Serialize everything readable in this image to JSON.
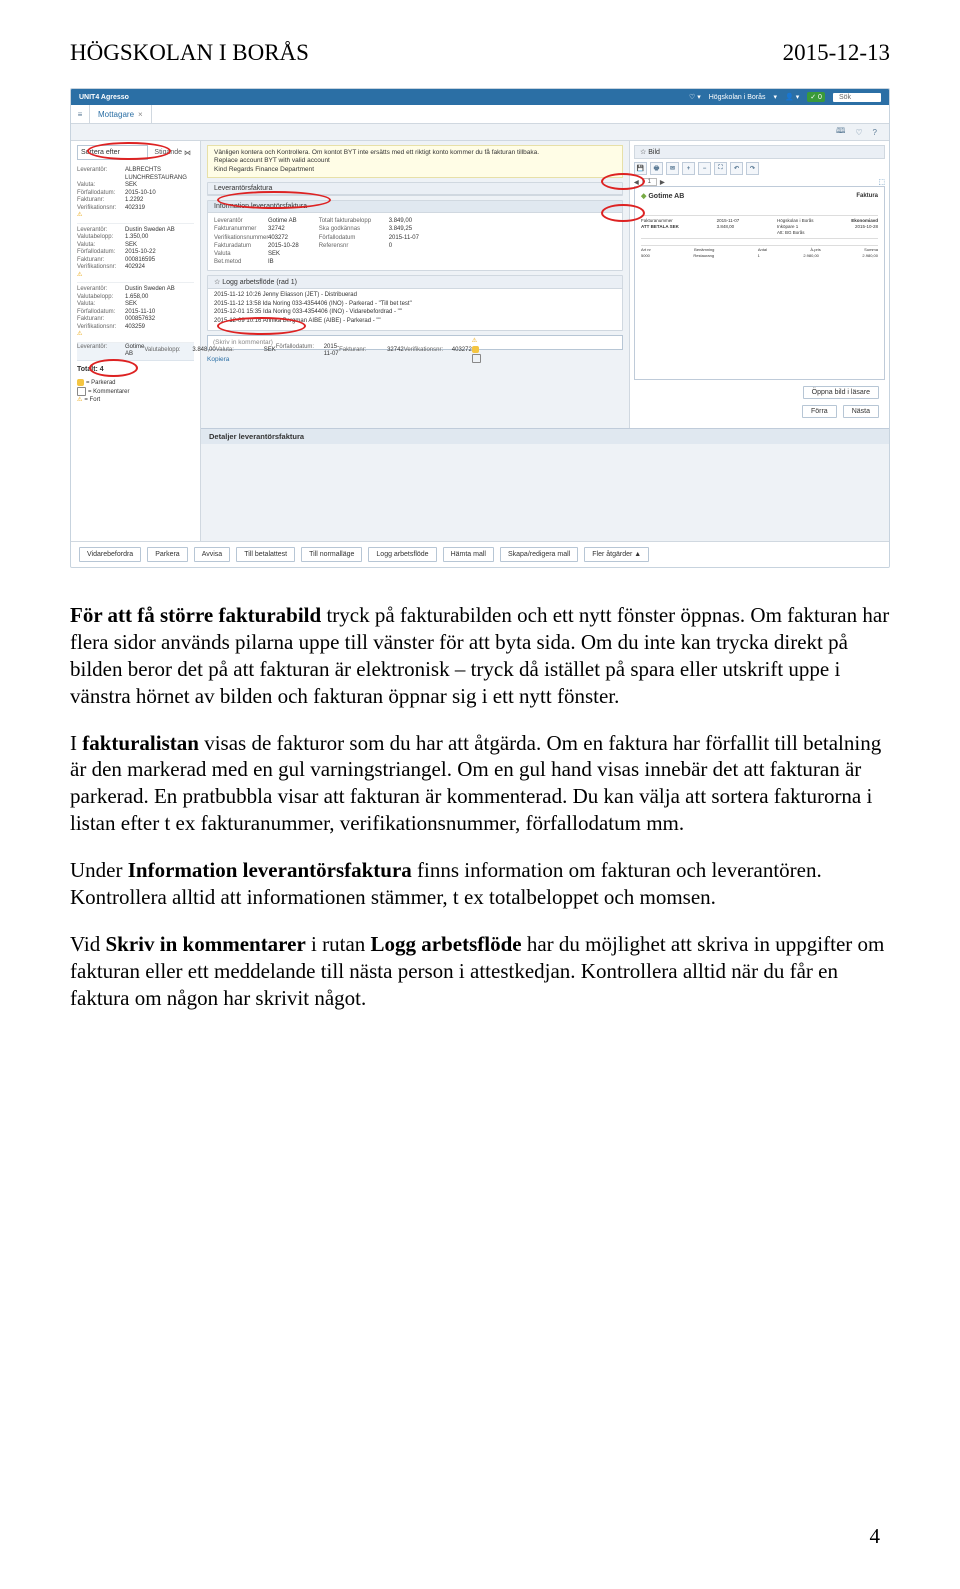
{
  "header": {
    "left": "HÖGSKOLAN I BORÅS",
    "right": "2015-12-13"
  },
  "topbar": {
    "brand": "UNIT4 Agresso",
    "org": "Högskolan i Borås",
    "search": "Sök"
  },
  "tab": {
    "label": "Mottagare",
    "close": "×"
  },
  "side": {
    "sort": "Sortera efter",
    "dir": "Stigande",
    "items": [
      {
        "lev": "ALBRECHTS LUNCHRESTAURANG",
        "bel": "",
        "val": "SEK",
        "forf": "2015-10-10",
        "fnr": "1.2292",
        "ver": "402319"
      },
      {
        "lev": "Dustin Sweden AB",
        "bel": "1.350,00",
        "val": "SEK",
        "forf": "2015-10-22",
        "fnr": "000816595",
        "ver": "402924"
      },
      {
        "lev": "Dustin Sweden AB",
        "bel": "1.658,00",
        "val": "SEK",
        "forf": "2015-11-10",
        "fnr": "000857632",
        "ver": "403259"
      },
      {
        "lev": "Gotime AB",
        "bel": "3.848,00",
        "val": "SEK",
        "forf": "2015-11-07",
        "fnr": "32742",
        "ver": "403272"
      }
    ],
    "labels": {
      "lev": "Leverantör:",
      "bel": "Valutabelopp:",
      "val": "Valuta:",
      "forf": "Förfallodatum:",
      "fnr": "Fakturanr:",
      "ver": "Verifikationsnr:"
    },
    "totalt": "Totalt: 4",
    "legend": {
      "park": "= Parkerad",
      "kom": "= Kommentarer",
      "fort": "= Fort"
    }
  },
  "msg": {
    "l1": "Vänligen kontera och Kontrollera. Om kontot BYT inte ersätts med ett riktigt konto kommer du få fakturan tillbaka.",
    "l2": "Replace account BYT with valid account",
    "l3": "Kind Regards Finance Department"
  },
  "panels": {
    "levfak": "Leverantörsfaktura",
    "info": "Information leverantörsfaktura",
    "log": "☆ Logg arbetsflöde (rad 1)",
    "detaljer": "Detaljer leverantörsfaktura",
    "bild": "☆ Bild"
  },
  "info": {
    "left": [
      {
        "k": "Leverantör",
        "v": "Gotime AB"
      },
      {
        "k": "Fakturanummer",
        "v": "32742"
      },
      {
        "k": "Verifikationsnummer",
        "v": "403272"
      },
      {
        "k": "Fakturadatum",
        "v": "2015-10-28"
      },
      {
        "k": "Valuta",
        "v": "SEK"
      },
      {
        "k": "Bet.metod",
        "v": "IB"
      }
    ],
    "right": [
      {
        "k": "Totalt fakturabelopp",
        "v": "3.849,00"
      },
      {
        "k": "Ska godkännas",
        "v": "3.849,25"
      },
      {
        "k": "Förfallodatum",
        "v": "2015-11-07"
      },
      {
        "k": "Referensnr",
        "v": "0"
      }
    ]
  },
  "log": [
    "2015-11-12 10:26 Jenny Eliasson (JET) - Distribuerad",
    "2015-11-12 13:58 Ida Noring 033-4354406 (INO) - Parkerad - \"Till bet test\"",
    "2015-12-01 15:35 Ida Noring 033-4354406 (INO) - Vidarebefordrad - \"\"",
    "2015-12-09 10:16 Annika Bergman AIBE (AIBE) - Parkerad - \"\""
  ],
  "comment": "(Skriv in kommentar)",
  "kopiera": "Kopiera",
  "doc": {
    "name": "Gotime AB",
    "type": "Faktura",
    "addr": "Högskolan i Borås",
    "ref": "Ekonomiavd",
    "date": "2015-10-28",
    "att": "ATT BETALA SEK",
    "bel": "3.848,00",
    "org": "Att: BG Borås"
  },
  "nav": {
    "open": "Öppna bild i läsare",
    "prev": "Förra",
    "next": "Nästa"
  },
  "footbtns": [
    "Vidarebefordra",
    "Parkera",
    "Avvisa",
    "Till betalattest",
    "Till normalläge",
    "Logg arbetsflöde",
    "Hämta mall",
    "Skapa/redigera mall",
    "Fler åtgärder ▲"
  ],
  "page": {
    "cur": "1",
    "ctrl_prev": "◀",
    "ctrl_next": "▶"
  },
  "body": {
    "p1a": "För att få större fakturabild ",
    "p1b": "tryck på fakturabilden och ett nytt fönster öppnas. Om fakturan har flera sidor används pilarna uppe till vänster för att byta sida. Om du inte kan trycka direkt på bilden beror det på att fakturan är elektronisk – tryck då istället på spara eller utskrift uppe i vänstra hörnet av bilden och fakturan öppnar sig i ett nytt fönster.",
    "p2a": "I ",
    "p2b": "fakturalistan",
    "p2c": " visas de fakturor som du har att åtgärda. Om en faktura har förfallit till betalning är den markerad med en gul varningstriangel. Om en gul hand visas innebär det att fakturan är parkerad. En pratbubbla visar att fakturan är kommenterad. Du kan välja att sortera fakturorna i listan efter t ex fakturanummer, verifikationsnummer, förfallodatum mm.",
    "p3a": "Under ",
    "p3b": "Information leverantörsfaktura",
    "p3c": " finns information om fakturan och leverantören. Kontrollera alltid att informationen stämmer, t ex totalbeloppet och momsen.",
    "p4a": "Vid ",
    "p4b": "Skriv in kommentarer",
    "p4c": " i rutan ",
    "p4d": "Logg arbetsflöde",
    "p4e": " har du möjlighet att skriva in uppgifter om fakturan eller ett meddelande till nästa person i attestkedjan. Kontrollera alltid när du får en faktura om någon har skrivit något."
  },
  "pagenum": "4"
}
